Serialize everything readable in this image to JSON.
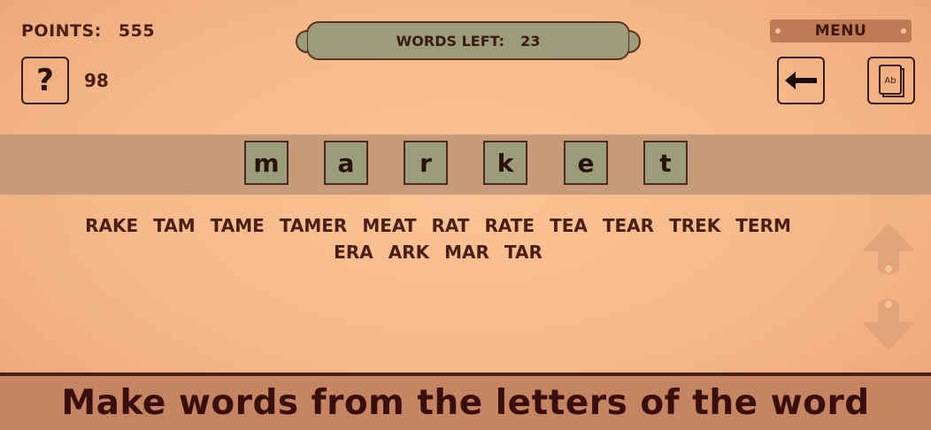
{
  "header": {
    "points_label": "POINTS:",
    "points_value": "555",
    "words_left_label": "WORDS LEFT:",
    "words_left_value": "23",
    "menu_label": "MENU"
  },
  "hint": {
    "symbol": "?",
    "count": "98"
  },
  "dictionary": {
    "icon_text": "Ab"
  },
  "letters": [
    "m",
    "a",
    "r",
    "k",
    "e",
    "t"
  ],
  "found_words": {
    "row1": [
      "RAKE",
      "TAM",
      "TAME",
      "TAMER",
      "MEAT",
      "RAT",
      "RATE",
      "TEA",
      "TEAR",
      "TREK",
      "TERM"
    ],
    "row2": [
      "ERA",
      "ARK",
      "MAR",
      "TAR"
    ]
  },
  "footer": {
    "caption": "Make words from the letters of the word"
  },
  "icons": {
    "hint": "question-icon",
    "back": "arrow-left-icon",
    "dictionary": "book-icon",
    "scroll_up": "arrow-up-icon",
    "scroll_down": "arrow-down-icon"
  },
  "colors": {
    "background": "#f6b889",
    "tile": "#9b9c7a",
    "band": "#c69a7a",
    "footer": "#c58563",
    "text_dark": "#3a1a12"
  }
}
